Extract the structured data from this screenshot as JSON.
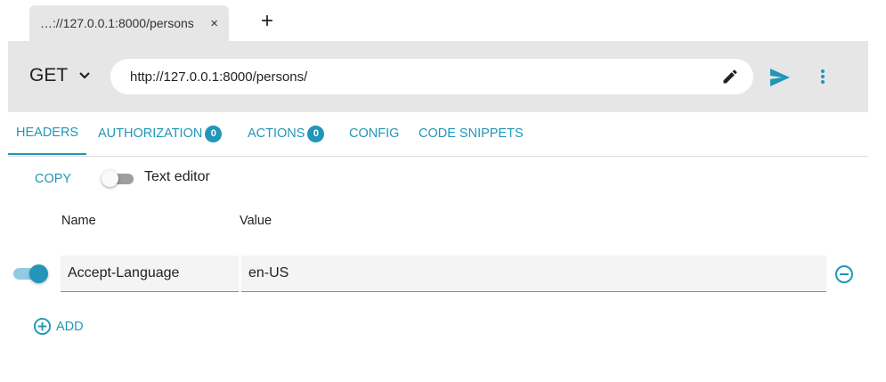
{
  "browser_tab": {
    "title": "…://127.0.0.1:8000/persons",
    "close_glyph": "×",
    "new_tab_glyph": "+"
  },
  "request": {
    "method": "GET",
    "url": "http://127.0.0.1:8000/persons/",
    "icons": {
      "method_dropdown": "chevron-down-icon",
      "edit": "pencil-icon",
      "send": "send-icon",
      "more": "more-vert-icon"
    }
  },
  "tabs": [
    {
      "label": "HEADERS",
      "active": true
    },
    {
      "label": "AUTHORIZATION",
      "badge": "0"
    },
    {
      "label": "ACTIONS",
      "badge": "0"
    },
    {
      "label": "CONFIG"
    },
    {
      "label": "CODE SNIPPETS"
    }
  ],
  "headers_panel": {
    "copy_label": "COPY",
    "text_editor_label": "Text editor",
    "text_editor_enabled": false,
    "columns": {
      "name": "Name",
      "value": "Value"
    },
    "rows": [
      {
        "enabled": true,
        "name": "Accept-Language",
        "value": "en-US"
      }
    ],
    "add_label": "ADD"
  },
  "colors": {
    "accent": "#2196b8",
    "bar_bg": "#e6e6e6"
  }
}
